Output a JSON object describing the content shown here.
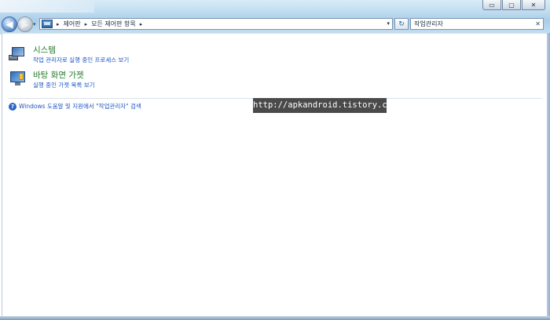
{
  "window": {
    "caption_buttons": {
      "minimize": "▭",
      "maximize": "▢",
      "close": "✕"
    }
  },
  "nav": {
    "back_symbol": "◀",
    "forward_symbol": "▶",
    "dropdown_symbol": "▾"
  },
  "address": {
    "breadcrumbs": [
      "제어판",
      "모든 제어판 항목"
    ],
    "separator": "▸",
    "dropdown_symbol": "▾",
    "refresh_symbol": "↻"
  },
  "search": {
    "value": "작업관리자",
    "clear_symbol": "✕"
  },
  "results": [
    {
      "title": "시스템",
      "subtitle": "작업 관리자로 실행 중인 프로세스 보기",
      "icon": "system-icon"
    },
    {
      "title": "바탕 화면 가젯",
      "subtitle": "실행 중인 가젯 목록 보기",
      "icon": "desktop-gadgets-icon"
    }
  ],
  "help": {
    "icon_symbol": "?",
    "text": "Windows 도움말 및 지원에서 \"작업관리자\" 검색"
  },
  "watermark": {
    "text": "http://apkandroid.tistory.com"
  },
  "colors": {
    "result_title": "#1d7a22",
    "link": "#1b55c6",
    "watermark_bg": "#4a4a4a"
  }
}
